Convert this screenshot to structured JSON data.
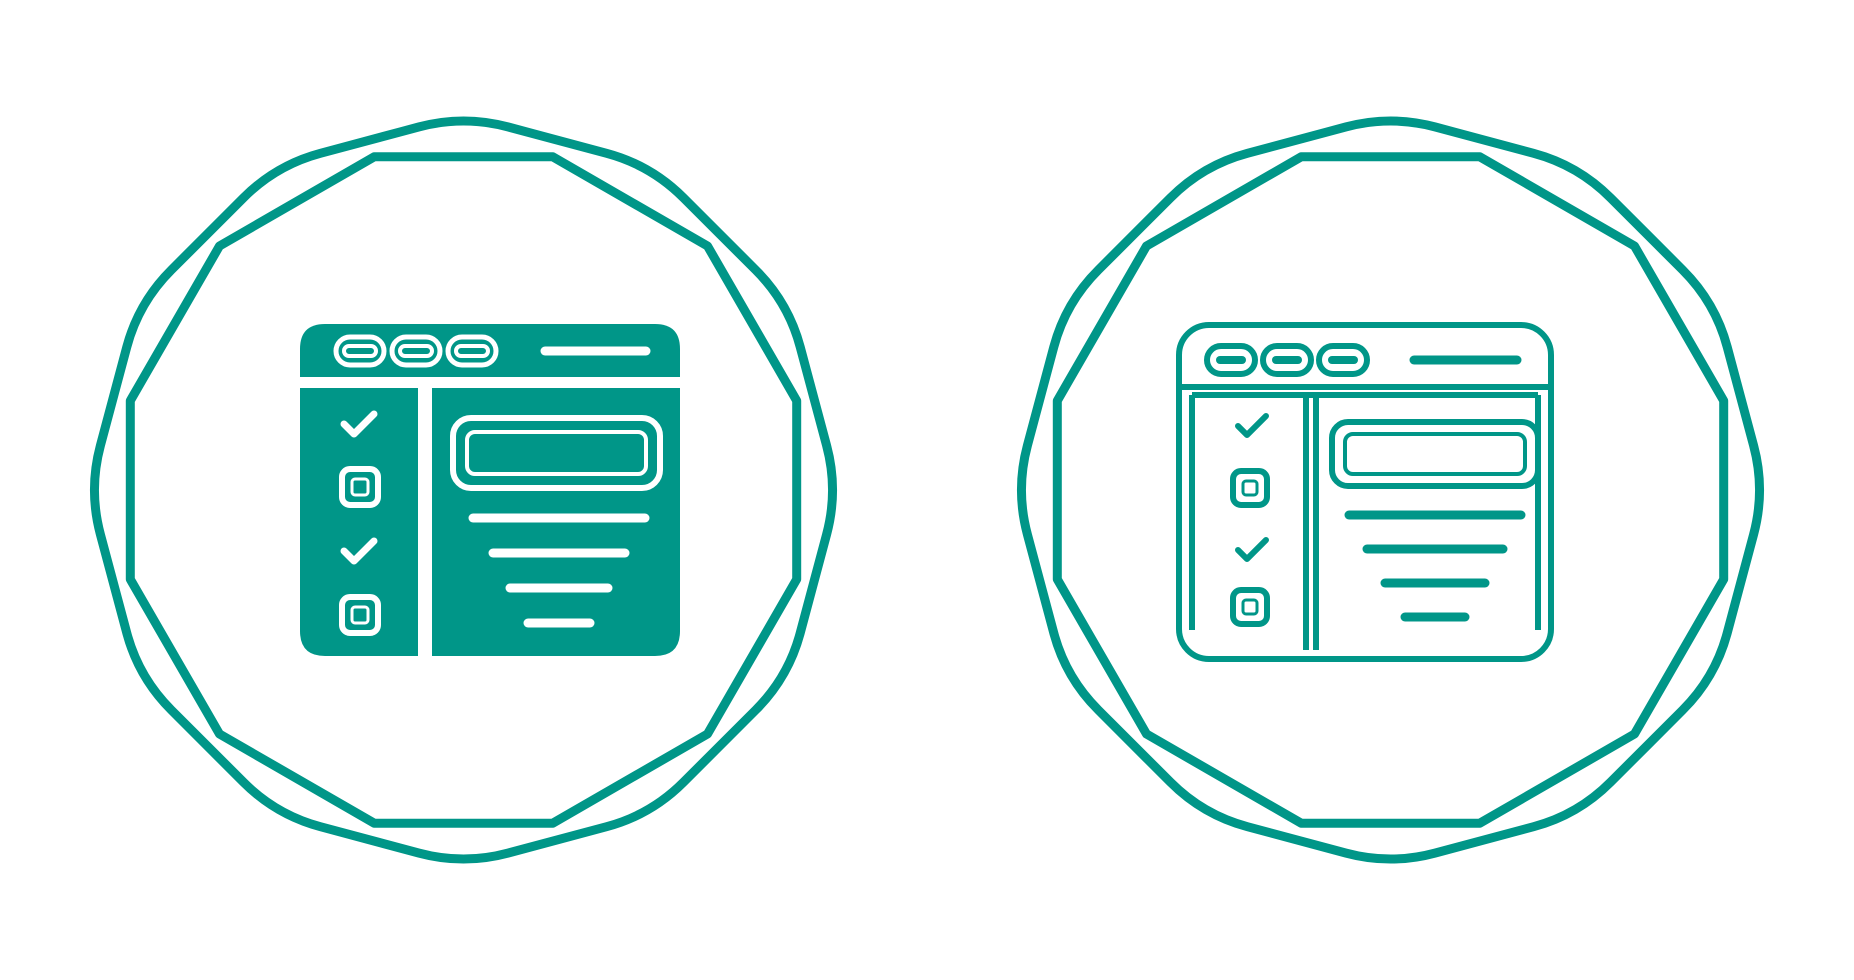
{
  "colors": {
    "accent": "#009688",
    "background": "#ffffff"
  },
  "icons": [
    {
      "name": "checklist-window-icon",
      "style": "filled"
    },
    {
      "name": "checklist-window-icon",
      "style": "outline"
    }
  ]
}
